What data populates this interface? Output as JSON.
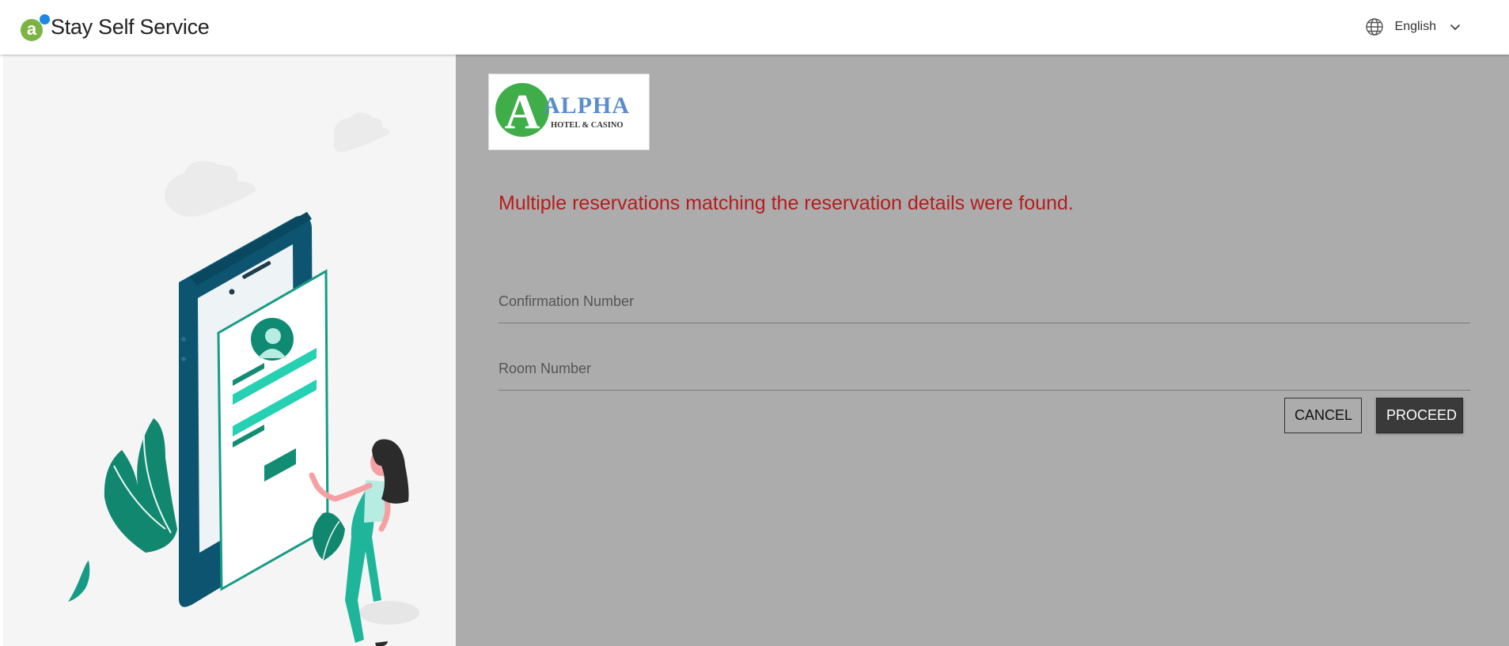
{
  "header": {
    "brand_letter": "a",
    "brand_name": "Stay Self Service",
    "language": "English"
  },
  "hotel": {
    "logo_letter": "A",
    "logo_name": "ALPHA",
    "logo_subtitle": "HOTEL & CASINO"
  },
  "form": {
    "message": "Multiple reservations matching the reservation details were found.",
    "confirmation_placeholder": "Confirmation Number",
    "confirmation_value": "",
    "room_placeholder": "Room Number",
    "room_value": "",
    "cancel_label": "CANCEL",
    "proceed_label": "PROCEED"
  },
  "colors": {
    "brand_green": "#7cb342",
    "brand_blue": "#1e88e5",
    "error_red": "#b71c1c",
    "panel_gray": "#acacac",
    "teal": "#1a9985"
  }
}
